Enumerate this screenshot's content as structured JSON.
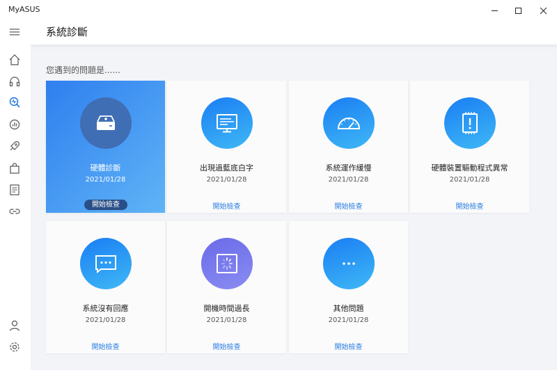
{
  "app": {
    "name": "MyASUS"
  },
  "window_controls": [
    {
      "name": "minimize-button",
      "icon": "minimize-icon"
    },
    {
      "name": "maximize-button",
      "icon": "maximize-icon"
    },
    {
      "name": "close-button",
      "icon": "close-icon"
    }
  ],
  "sidebar": {
    "top_items": [
      {
        "icon": "menu-icon"
      },
      {
        "icon": "home-icon"
      },
      {
        "icon": "headset-icon"
      },
      {
        "icon": "diagnosis-icon"
      },
      {
        "icon": "system-info-icon"
      },
      {
        "icon": "rocket-icon"
      },
      {
        "icon": "shopping-bag-icon"
      },
      {
        "icon": "news-icon"
      },
      {
        "icon": "link-icon"
      }
    ],
    "bottom_items": [
      {
        "icon": "user-icon"
      },
      {
        "icon": "settings-icon"
      }
    ]
  },
  "header": {
    "title": "系統診斷"
  },
  "main": {
    "subtitle": "您遇到的問題是......",
    "cards": [
      {
        "title": "硬體診斷",
        "date": "2021/01/28",
        "button": "開始檢查",
        "icon": "drive-icon",
        "active": true
      },
      {
        "title": "出現過藍底白字",
        "date": "2021/01/28",
        "button": "開始檢查",
        "icon": "monitor-icon"
      },
      {
        "title": "系統運作緩慢",
        "date": "2021/01/28",
        "button": "開始檢查",
        "icon": "speedometer-icon"
      },
      {
        "title": "硬體裝置驅動程式異常",
        "date": "2021/01/28",
        "button": "開始檢查",
        "icon": "chip-warning-icon"
      },
      {
        "title": "系統沒有回應",
        "date": "2021/01/28",
        "button": "開始檢查",
        "icon": "chat-dots-icon"
      },
      {
        "title": "開機時間過長",
        "date": "2021/01/28",
        "button": "開始檢查",
        "icon": "loading-screen-icon"
      },
      {
        "title": "其他問題",
        "date": "2021/01/28",
        "button": "開始檢查",
        "icon": "ellipsis-icon"
      }
    ]
  },
  "colors": {
    "accent": "#2a7de1",
    "active_card_start": "#2f7fef",
    "active_card_end": "#5fb4f6",
    "icon_circle_blue": "#1a7ef4",
    "icon_circle_purple": "#6a6be8",
    "background": "#f2f4f7"
  }
}
